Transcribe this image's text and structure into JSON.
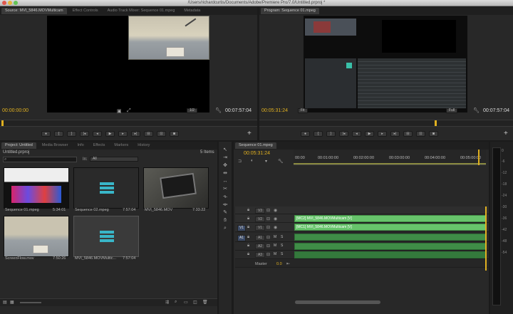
{
  "window": {
    "title": "/Users/richardcurtis/Documents/Adobe/Premiere Pro/7.0/Untitled.prproj *"
  },
  "source_panel": {
    "tabs": [
      "Source: MVI_5846.MOVMulticam",
      "Effect Controls",
      "Audio Track Mixer: Sequence 01.mpeg",
      "Metadata"
    ],
    "timecode_in": "00:00:00:00",
    "timecode_out": "00:07:57:04",
    "zoom": "1/2"
  },
  "program_panel": {
    "tabs": [
      "Program: Sequence 01.mpeg"
    ],
    "timecode_in": "00:05:31:24",
    "timecode_out": "00:07:57:04",
    "fit": "Fit",
    "quality": "Full"
  },
  "transport_icons": [
    "marker",
    "in-point",
    "out-point",
    "go-to-in",
    "step-back",
    "play",
    "step-forward",
    "go-to-out",
    "insert",
    "overwrite"
  ],
  "project_panel": {
    "tabs": [
      "Project: Untitled",
      "Media Browser",
      "Info",
      "Effects",
      "Markers",
      "History"
    ],
    "project_file": "Untitled.prproj",
    "item_count": "5 Items",
    "in_label": "In:",
    "in_value": "All",
    "items": [
      {
        "name": "Sequence 01.mpeg",
        "duration": "5:34:01"
      },
      {
        "name": "Sequence 02.mpeg",
        "duration": "7:57:04"
      },
      {
        "name": "MVI_5846.MOV",
        "duration": "7:33:22"
      },
      {
        "name": "ScreenFlow.mov",
        "duration": "7:50:26"
      },
      {
        "name": "MVI_5846.MOVMultic...",
        "duration": "7:57:04"
      }
    ]
  },
  "timeline": {
    "tab": "Sequence 01.mpeg",
    "timecode": "00:05:31:24",
    "ruler": [
      "00:00",
      "00:01:00:00",
      "00:02:00:00",
      "00:03:00:00",
      "00:04:00:00",
      "00:05:00:00"
    ],
    "video_tracks": [
      "V3",
      "V2",
      "V1"
    ],
    "audio_tracks": [
      "A1",
      "A2",
      "A3"
    ],
    "source_v": "V1",
    "source_a": "A1",
    "mute": "M",
    "solo": "S",
    "master_label": "Master",
    "master_value": "0.0",
    "clip_v2": "[MC2] MVI_5846.MOVMulticam [V]",
    "clip_v1": "[MC1] MVI_5846.MOVMulticam [V]"
  },
  "audio_meter": {
    "ticks": [
      "0",
      "-6",
      "-12",
      "-18",
      "-24",
      "-30",
      "-36",
      "-42",
      "-48",
      "-54"
    ]
  },
  "colors": {
    "timecode": "#e0b020",
    "clip_video": "#67c46b",
    "clip_audio": "#3f8d47",
    "panel": "#282828"
  }
}
